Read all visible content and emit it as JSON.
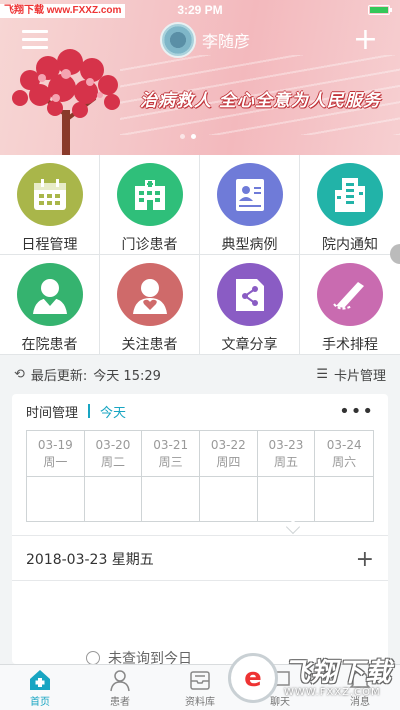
{
  "status_bar": {
    "time": "3:29 PM",
    "watermark": "飞翔下载 www.FXXZ.com"
  },
  "header": {
    "user_name": "李随彦",
    "slogan": "治病救人 全心全意为人民服务",
    "carousel_dots": 2,
    "active_dot": 1
  },
  "grid": {
    "items": [
      {
        "label": "日程管理",
        "icon": "calendar-icon",
        "color": "#a9b64a"
      },
      {
        "label": "门诊患者",
        "icon": "hospital-icon",
        "color": "#2fbf7a"
      },
      {
        "label": "典型病例",
        "icon": "case-file-icon",
        "color": "#6f7bd8"
      },
      {
        "label": "院内通知",
        "icon": "building-icon",
        "color": "#22b3a8"
      },
      {
        "label": "在院患者",
        "icon": "patient-icon",
        "color": "#35b36f"
      },
      {
        "label": "关注患者",
        "icon": "heart-person-icon",
        "color": "#cf6a6a"
      },
      {
        "label": "文章分享",
        "icon": "share-icon",
        "color": "#8a5cc4"
      },
      {
        "label": "手术排程",
        "icon": "scalpel-icon",
        "color": "#c96bb0"
      }
    ]
  },
  "update_bar": {
    "label": "最后更新:",
    "value": "今天 15:29",
    "card_mgmt": "卡片管理"
  },
  "schedule": {
    "title": "时间管理",
    "today_link": "今天",
    "more": "•••",
    "days": [
      {
        "date": "03-19",
        "weekday": "周一"
      },
      {
        "date": "03-20",
        "weekday": "周二"
      },
      {
        "date": "03-21",
        "weekday": "周三"
      },
      {
        "date": "03-22",
        "weekday": "周四"
      },
      {
        "date": "03-23",
        "weekday": "周五"
      },
      {
        "date": "03-24",
        "weekday": "周六"
      }
    ],
    "selected_date": "2018-03-23 星期五",
    "add": "+",
    "empty_text": "未查询到今日"
  },
  "tabbar": {
    "tabs": [
      {
        "label": "首页",
        "active": true
      },
      {
        "label": "患者",
        "active": false
      },
      {
        "label": "资料库",
        "active": false
      },
      {
        "label": "聊天",
        "active": false
      },
      {
        "label": "消息",
        "active": false
      }
    ]
  },
  "watermark_br": {
    "logo": "e",
    "big": "飞翔下载",
    "small": "WWW.FXXZ.COM"
  },
  "accent_color": "#18a5c2"
}
